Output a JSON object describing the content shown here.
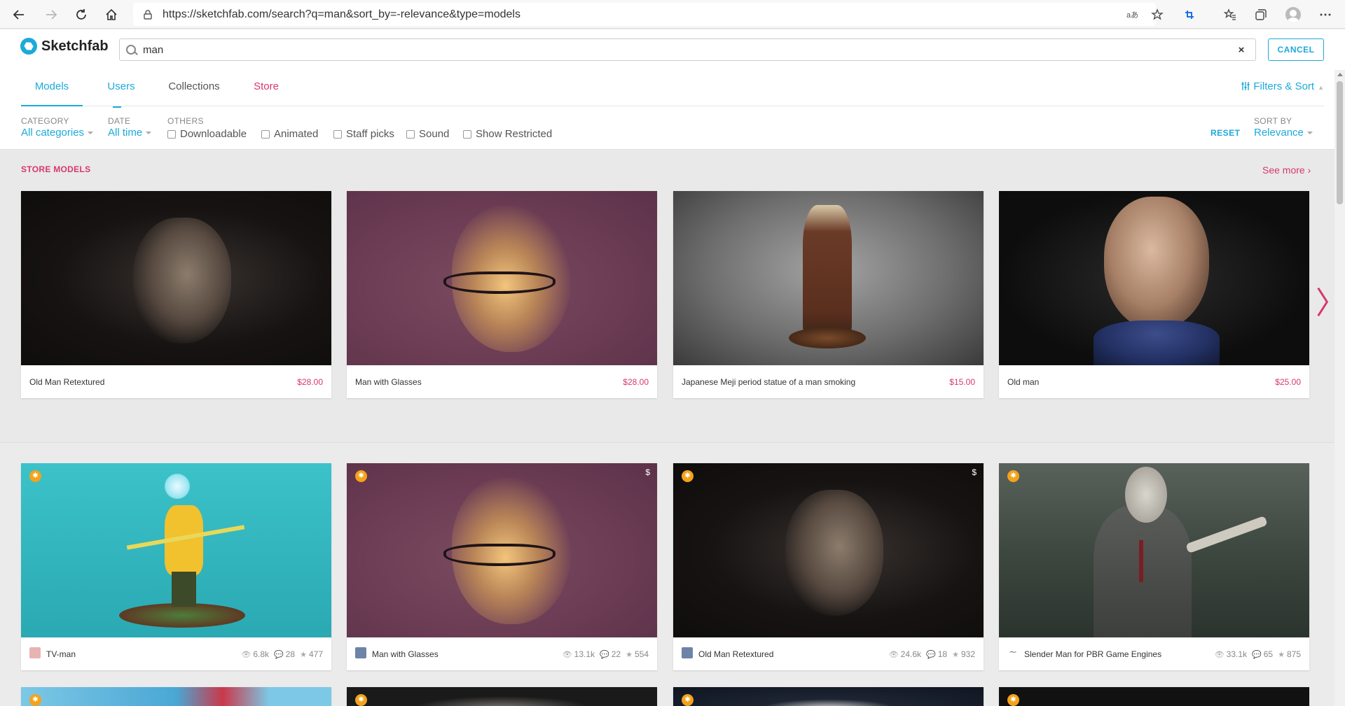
{
  "browser": {
    "url": "https://sketchfab.com/search?q=man&sort_by=-relevance&type=models"
  },
  "header": {
    "logo_text": "Sketchfab",
    "search_value": "man",
    "clear_icon": "×",
    "cancel_label": "CANCEL"
  },
  "tabs": {
    "models": "Models",
    "users": "Users",
    "collections": "Collections",
    "store": "Store",
    "filters_sort": "Filters & Sort"
  },
  "filters": {
    "category_label": "CATEGORY",
    "category_value": "All categories",
    "date_label": "DATE",
    "date_value": "All time",
    "others_label": "OTHERS",
    "checkboxes": [
      "Downloadable",
      "Animated",
      "Staff picks",
      "Sound",
      "Show Restricted"
    ],
    "reset_label": "RESET",
    "sort_label": "SORT BY",
    "sort_value": "Relevance"
  },
  "store": {
    "title": "STORE MODELS",
    "see_more": "See more ›",
    "next_arrow": "〉",
    "items": [
      {
        "name": "Old Man Retextured",
        "price": "$28.00"
      },
      {
        "name": "Man with Glasses",
        "price": "$28.00"
      },
      {
        "name": "Japanese Meji period statue of a man smoking",
        "price": "$15.00"
      },
      {
        "name": "Old man",
        "price": "$25.00"
      }
    ]
  },
  "models": {
    "items": [
      {
        "name": "TV-man",
        "views": "6.8k",
        "comments": "28",
        "likes": "477"
      },
      {
        "name": "Man with Glasses",
        "views": "13.1k",
        "comments": "22",
        "likes": "554"
      },
      {
        "name": "Old Man Retextured",
        "views": "24.6k",
        "comments": "18",
        "likes": "932"
      },
      {
        "name": "Slender Man for PBR Game Engines",
        "views": "33.1k",
        "comments": "65",
        "likes": "875"
      }
    ],
    "dollar_badge": "$"
  },
  "colors": {
    "accent": "#1caad9",
    "store_pink": "#d7386b",
    "staff_pick": "#f3a31a"
  },
  "icons": {
    "back": "back-arrow-icon",
    "forward": "forward-arrow-icon",
    "reload": "reload-icon",
    "home": "home-icon",
    "lock": "lock-icon",
    "search": "search-icon",
    "views": "eye-icon",
    "comments": "comment-icon",
    "likes": "star-icon",
    "staff": "staff-pick-icon"
  }
}
